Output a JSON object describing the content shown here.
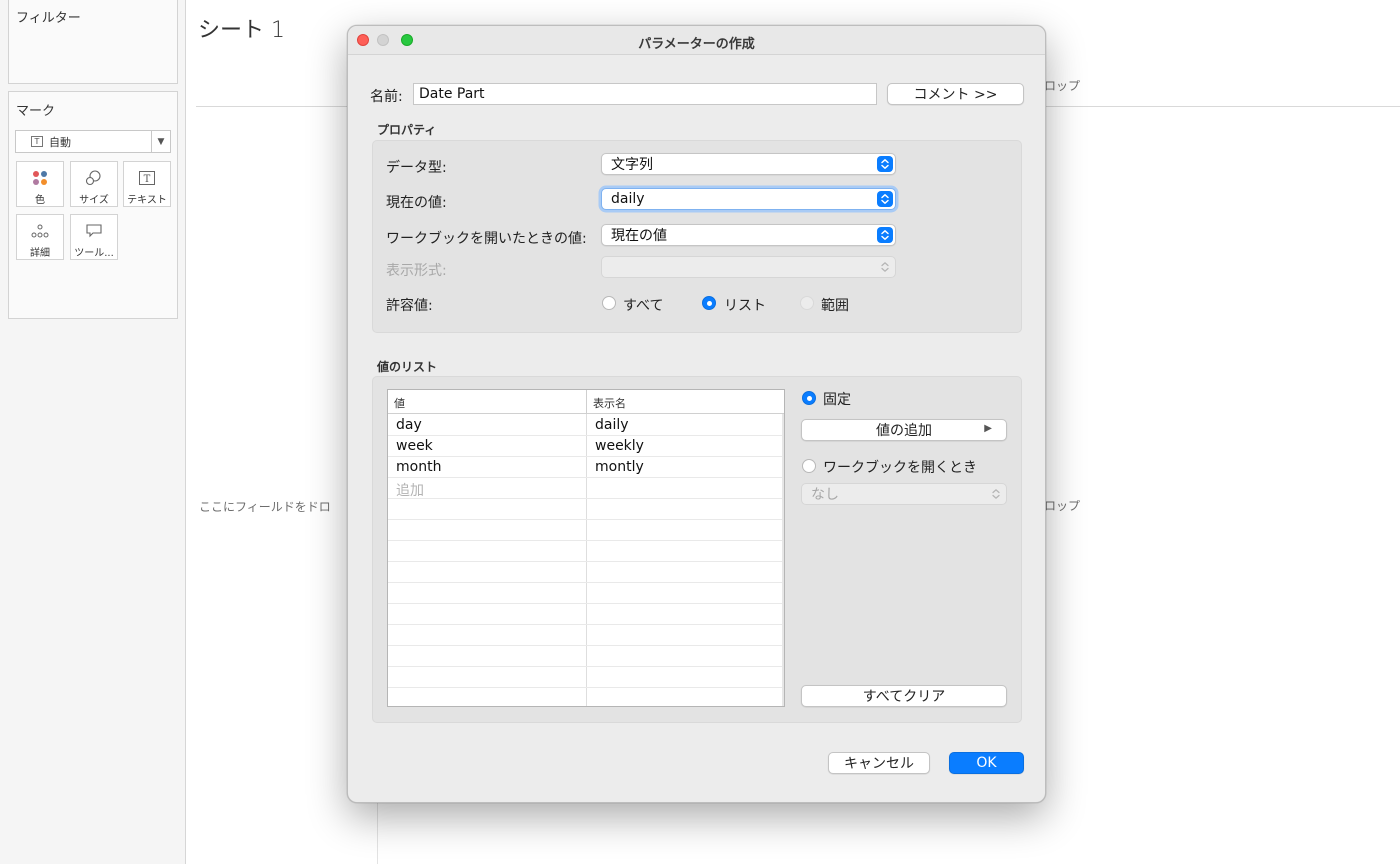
{
  "workspace": {
    "filters_title": "フィルター",
    "marks_title": "マーク",
    "mark_type": "自動",
    "mark_buttons": [
      {
        "label": "色",
        "icon": "color-dots-icon"
      },
      {
        "label": "サイズ",
        "icon": "size-shapes-icon"
      },
      {
        "label": "テキスト",
        "icon": "text-t-icon"
      },
      {
        "label": "詳細",
        "icon": "detail-dots-icon"
      },
      {
        "label": "ツール...",
        "icon": "tooltip-icon"
      }
    ],
    "sheet_title": "シート 1",
    "drop_hint_left": "ここにフィールドをドロ",
    "drop_hint_top_right": "ロップ",
    "drop_hint_mid_right": "ロップ"
  },
  "dialog": {
    "title": "パラメーターの作成",
    "name_label": "名前:",
    "name_value": "Date Part",
    "comment_button": "コメント >>",
    "properties_title": "プロパティ",
    "data_type_label": "データ型:",
    "data_type_value": "文字列",
    "current_value_label": "現在の値:",
    "current_value": "daily",
    "workbook_open_label": "ワークブックを開いたときの値:",
    "workbook_open_value": "現在の値",
    "display_format_label": "表示形式:",
    "display_format_value": "",
    "allowable_label": "許容値:",
    "allowable_options": [
      "すべて",
      "リスト",
      "範囲"
    ],
    "allowable_selected": "リスト",
    "value_list_title": "値のリスト",
    "list_columns": [
      "値",
      "表示名"
    ],
    "list_rows": [
      {
        "value": "day",
        "display": "daily"
      },
      {
        "value": "week",
        "display": "weekly"
      },
      {
        "value": "month",
        "display": "montly"
      }
    ],
    "add_placeholder": "追加",
    "fixed_label": "固定",
    "add_values_button": "値の追加",
    "on_workbook_open_label": "ワークブックを開くとき",
    "on_workbook_open_value": "なし",
    "clear_all_button": "すべてクリア",
    "cancel_button": "キャンセル",
    "ok_button": "OK"
  },
  "colors": {
    "accent": "#0a7dff",
    "close": "#fe5f57",
    "maximize": "#28c840"
  }
}
